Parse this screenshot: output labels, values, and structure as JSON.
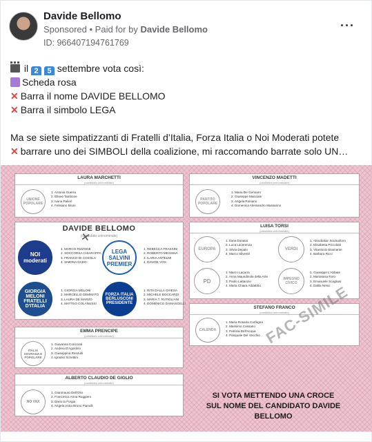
{
  "post": {
    "author": "Davide Bellomo",
    "sponsored": "Sponsored",
    "paid_for_prefix": "Paid for by",
    "paid_for_name": "Davide Bellomo",
    "ad_id": "ID: 966407194761769",
    "more_icon": "more-horizontal-icon",
    "lines": {
      "l1_a": "il",
      "l1_d1": "2",
      "l1_d2": "5",
      "l1_b": "settembre vota così:",
      "l2": "Scheda rosa",
      "l3": "Barra il nome DAVIDE BELLOMO",
      "l4": "Barra il simbolo LEGA",
      "l5": "Ma se siete simpatizzanti di Fratelli d’Italia, Forza Italia o Noi Moderati potete",
      "l6": "barrare uno dei SIMBOLI della coalizione, mi raccomando barrate solo UN…"
    }
  },
  "ballot": {
    "sub_label": "(candidato uninominale)",
    "left": [
      {
        "title": "LAURA MARCHETTI",
        "logos": [
          "UNIONE POPOLARE"
        ],
        "names": [
          "1. Antonia Guerra",
          "2. Eliseo Tambone",
          "3. Ivana Palieri",
          "4. Felisiano Bruni"
        ]
      },
      {
        "title": "DAVIDE BELLOMO",
        "parties": [
          {
            "logo": "NOI moderati",
            "names": [
              "1. MARCO RIZZONE",
              "2. SOCCORSA CHIARAPPA",
              "3. FRANCO DI COSOLA",
              "4. SIMONA DADO"
            ]
          },
          {
            "logo": "LEGA SALVINI PREMIER",
            "names": [
              "1. REBECCA FRASSINI",
              "2. ROBERTO MESSINA",
              "3. ILARIA ANTELMI",
              "4. DAVIDE VOX"
            ]
          },
          {
            "logo": "GIORGIA MELONI FRATELLI D'ITALIA",
            "names": [
              "1. GIORGIA MELONI",
              "2. MARCELLO GEMMATO",
              "3. LAURA DE MARZO",
              "4. MATTEO COLANUSSI"
            ]
          },
          {
            "logo": "FORZA ITALIA BERLUSCONI PRESIDENTE",
            "names": [
              "1. RITA DALLA CHIESA",
              "2. MICHELE BOCCARDI",
              "3. MARIA T. RUTIGLIANI",
              "4. DOMENICO DAMASCELLI"
            ]
          }
        ]
      },
      {
        "title": "EMMA PRENCIPE",
        "logos": [
          "ITALIA SOVRANA E POPOLARE"
        ],
        "names": [
          "1. Giovanna Coricciati",
          "2. Andrea D'Agostino",
          "3. Giuseppina Renzulli",
          "4. Ignazio Schettini"
        ]
      },
      {
        "title": "ALBERTO CLAUDIO DE GIGLIO",
        "logos": [
          "NO VAX"
        ],
        "names": [
          "1. Gianmauro Dell'Olio",
          "2. Francesca Anna Ruggiero",
          "3. Dario la Forgia",
          "4. Angela Anna Bruno Pianulli"
        ]
      }
    ],
    "right": [
      {
        "title": "VINCENZO MADETTI",
        "logos": [
          "PARTITO POPOLARE"
        ],
        "names": [
          "1. Maria De Gennaro",
          "2. Giuseppe Masciale",
          "3. Angela Roisano",
          "4. Domenica Alessandro Massarino"
        ]
      },
      {
        "title": "LUISA TORSI",
        "parties": [
          {
            "logo": "EUROPA",
            "names": [
              "1. Ilaria Donatio",
              "2. Luca Lacerenza",
              "3. Silvia Depalo",
              "4. Marco Silvestri"
            ]
          },
          {
            "logo": "VERDI",
            "names": [
              "1. Aboubakar Soumahoro",
              "2. Elisabetta Piccolotti",
              "3. Vitantonio Bramante",
              "4. Barbara Ricci"
            ]
          },
          {
            "logo": "PD",
            "names": [
              "1. Marco Lacarra",
              "2. Anna Maundinola della Arte",
              "3. Paolo Lattanzio",
              "4. Maria Chiara Addabbo"
            ]
          },
          {
            "logo": "IMPEGNO CIVICO",
            "names": [
              "1. Giuseppe L'Abbate",
              "2. Marialuisa Faro",
              "3. Emanuele Scagliusi",
              "4. Dalila Nesci"
            ]
          }
        ]
      },
      {
        "title": "STEFANO FRANCO",
        "logos": [
          "CALENDA"
        ],
        "names": [
          "1. Maria Rosaria Carfagna",
          "2. Massimo Cassano",
          "3. Patrizia Dell'Acqua",
          "4. Pasquale Del Vecchio"
        ]
      }
    ],
    "watermark": "FAC-SIMILE",
    "vote_line1": "SI VOTA METTENDO UNA CROCE",
    "vote_line2": "SUL NOME DEL CANDIDATO DAVIDE BELLOMO"
  }
}
